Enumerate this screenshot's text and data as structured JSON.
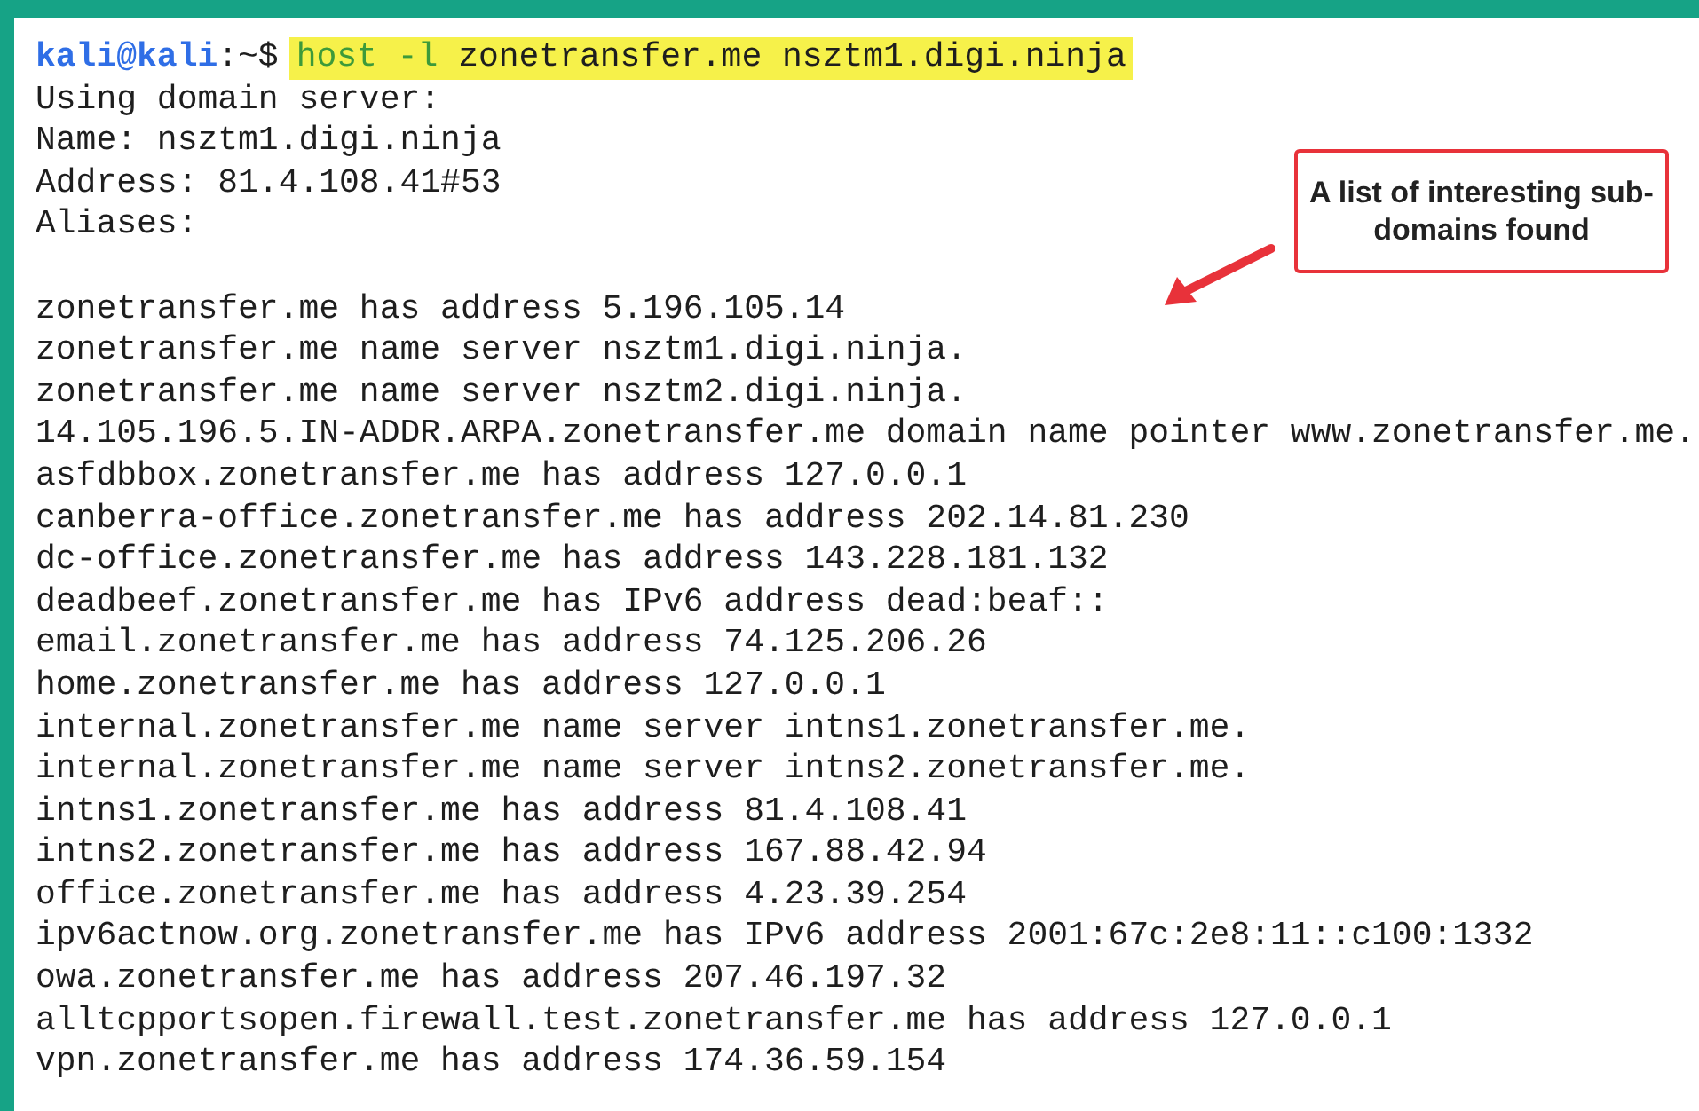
{
  "terminal": {
    "prompt": {
      "user_host": "kali@kali",
      "path": ":~$"
    },
    "command": {
      "program": "host",
      "flag": "-l",
      "arguments": "zonetransfer.me nsztm1.digi.ninja",
      "highlighted": true
    },
    "header_lines": [
      "Using domain server:",
      "Name: nsztm1.digi.ninja",
      "Address: 81.4.108.41#53",
      "Aliases:"
    ],
    "records": [
      "zonetransfer.me has address 5.196.105.14",
      "zonetransfer.me name server nsztm1.digi.ninja.",
      "zonetransfer.me name server nsztm2.digi.ninja.",
      "14.105.196.5.IN-ADDR.ARPA.zonetransfer.me domain name pointer www.zonetransfer.me.",
      "asfdbbox.zonetransfer.me has address 127.0.0.1",
      "canberra-office.zonetransfer.me has address 202.14.81.230",
      "dc-office.zonetransfer.me has address 143.228.181.132",
      "deadbeef.zonetransfer.me has IPv6 address dead:beaf::",
      "email.zonetransfer.me has address 74.125.206.26",
      "home.zonetransfer.me has address 127.0.0.1",
      "internal.zonetransfer.me name server intns1.zonetransfer.me.",
      "internal.zonetransfer.me name server intns2.zonetransfer.me.",
      "intns1.zonetransfer.me has address 81.4.108.41",
      "intns2.zonetransfer.me has address 167.88.42.94",
      "office.zonetransfer.me has address 4.23.39.254",
      "ipv6actnow.org.zonetransfer.me has IPv6 address 2001:67c:2e8:11::c100:1332",
      "owa.zonetransfer.me has address 207.46.197.32",
      "alltcpportsopen.firewall.test.zonetransfer.me has address 127.0.0.1",
      "vpn.zonetransfer.me has address 174.36.59.154"
    ]
  },
  "callout": {
    "text": "A list of interesting sub-domains found"
  }
}
